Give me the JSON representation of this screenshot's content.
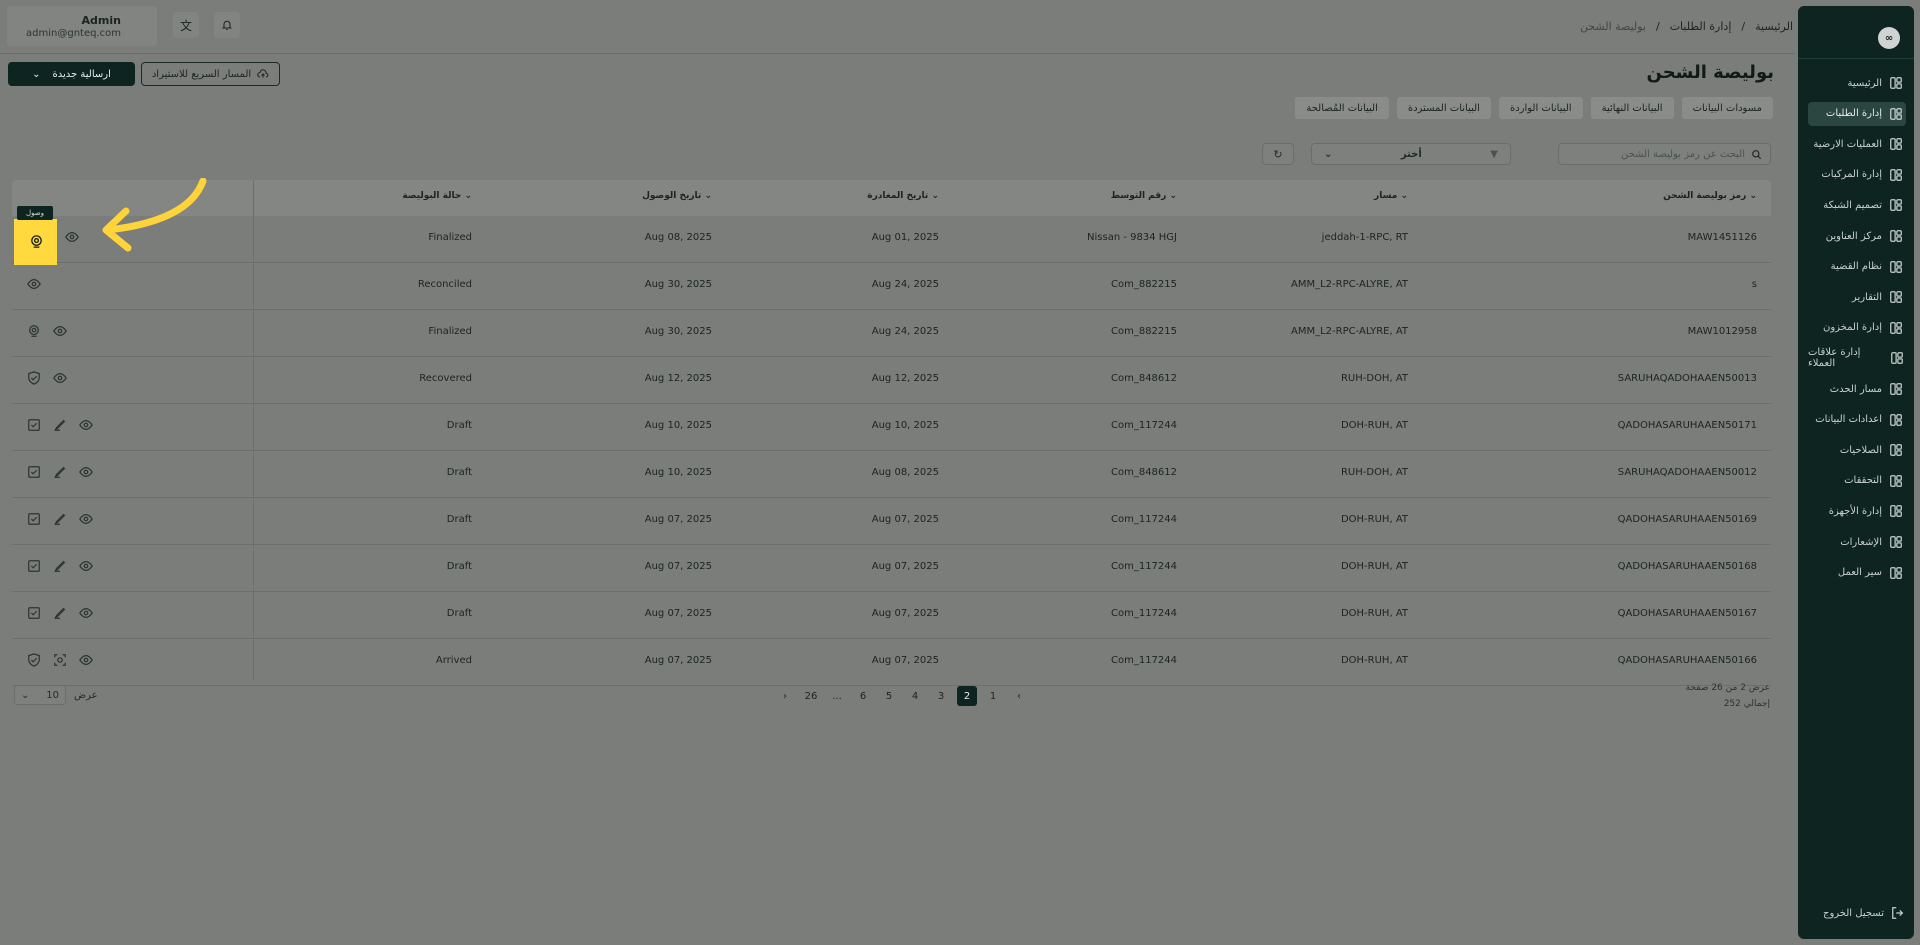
{
  "user": {
    "name": "Admin",
    "email": "admin@gnteq.com"
  },
  "breadcrumb": {
    "home": "الرئيسية",
    "section": "إدارة الطلبات",
    "current": "بوليصة الشحن"
  },
  "page": {
    "title": "بوليصة الشحن",
    "new_button": "ارسالية جديدة",
    "quick_button": "المسار السريع للاستيراد"
  },
  "tabs": [
    "مسودات البيانات",
    "البيانات النهائية",
    "البيانات الواردة",
    "البيانات المستردة",
    "البيانات المُصالحة"
  ],
  "search": {
    "placeholder": "البحث عن رمز بوليصة الشحن"
  },
  "filter": {
    "label": "أختر"
  },
  "sidebar": {
    "items": [
      {
        "label": "الرئيسية",
        "icon": "dashboard-icon"
      },
      {
        "label": "إدارة الطلبات",
        "icon": "orders-icon"
      },
      {
        "label": "العمليات الارضية",
        "icon": "ground-ops-icon"
      },
      {
        "label": "إدارة المركبات",
        "icon": "truck-icon"
      },
      {
        "label": "تصميم الشبكة",
        "icon": "network-icon"
      },
      {
        "label": "مركز العناوين",
        "icon": "address-icon"
      },
      {
        "label": "نظام القضية",
        "icon": "case-icon"
      },
      {
        "label": "التقارير",
        "icon": "reports-icon"
      },
      {
        "label": "إدارة المخزون",
        "icon": "inventory-icon"
      },
      {
        "label": "إدارة علاقات العملاء",
        "icon": "crm-icon"
      },
      {
        "label": "مسار الحدث",
        "icon": "event-path-icon"
      },
      {
        "label": "اعدادات البيانات",
        "icon": "database-icon"
      },
      {
        "label": "الصلاحيات",
        "icon": "users-icon"
      },
      {
        "label": "التحققات",
        "icon": "tools-icon"
      },
      {
        "label": "إدارة الأجهزة",
        "icon": "devices-icon"
      },
      {
        "label": "الإشعارات",
        "icon": "bell-icon"
      },
      {
        "label": "سير العمل",
        "icon": "workflow-icon"
      }
    ],
    "logout": "تسجيل الخروج",
    "logo": "∞"
  },
  "table": {
    "headers": {
      "code": "رمز بوليصة الشحن",
      "route": "مسار",
      "mid": "رقم التوسط",
      "dep": "تاريخ المغادرة",
      "arr": "تاريخ الوصول",
      "status": "حالة البوليصة"
    },
    "rows": [
      {
        "code": "MAW1451126",
        "route": "jeddah-1-RPC, RT",
        "mid": "Nissan - 9834 HGJ",
        "dep": "Aug 01, 2025",
        "arr": "Aug 08, 2025",
        "status": "Finalized",
        "actions": [
          "eye-icon"
        ]
      },
      {
        "code": "s",
        "route": "AMM_L2-RPC-ALYRE, AT",
        "mid": "Com_882215",
        "dep": "Aug 24, 2025",
        "arr": "Aug 30, 2025",
        "status": "Reconciled",
        "actions": [
          "eye-icon"
        ]
      },
      {
        "code": "MAW1012958",
        "route": "AMM_L2-RPC-ALYRE, AT",
        "mid": "Com_882215",
        "dep": "Aug 24, 2025",
        "arr": "Aug 30, 2025",
        "status": "Finalized",
        "actions": [
          "location-icon",
          "eye-icon"
        ]
      },
      {
        "code": "SARUHAQADOHAAEN50013",
        "route": "RUH-DOH, AT",
        "mid": "Com_848612",
        "dep": "Aug 12, 2025",
        "arr": "Aug 12, 2025",
        "status": "Recovered",
        "actions": [
          "shield-icon",
          "eye-icon"
        ]
      },
      {
        "code": "QADOHASARUHAAEN50171",
        "route": "DOH-RUH, AT",
        "mid": "Com_117244",
        "dep": "Aug 10, 2025",
        "arr": "Aug 10, 2025",
        "status": "Draft",
        "actions": [
          "checkbox-icon",
          "edit-icon",
          "eye-icon"
        ]
      },
      {
        "code": "SARUHAQADOHAAEN50012",
        "route": "RUH-DOH, AT",
        "mid": "Com_848612",
        "dep": "Aug 08, 2025",
        "arr": "Aug 10, 2025",
        "status": "Draft",
        "actions": [
          "checkbox-icon",
          "edit-icon",
          "eye-icon"
        ]
      },
      {
        "code": "QADOHASARUHAAEN50169",
        "route": "DOH-RUH, AT",
        "mid": "Com_117244",
        "dep": "Aug 07, 2025",
        "arr": "Aug 07, 2025",
        "status": "Draft",
        "actions": [
          "checkbox-icon",
          "edit-icon",
          "eye-icon"
        ]
      },
      {
        "code": "QADOHASARUHAAEN50168",
        "route": "DOH-RUH, AT",
        "mid": "Com_117244",
        "dep": "Aug 07, 2025",
        "arr": "Aug 07, 2025",
        "status": "Draft",
        "actions": [
          "checkbox-icon",
          "edit-icon",
          "eye-icon"
        ]
      },
      {
        "code": "QADOHASARUHAAEN50167",
        "route": "DOH-RUH, AT",
        "mid": "Com_117244",
        "dep": "Aug 07, 2025",
        "arr": "Aug 07, 2025",
        "status": "Draft",
        "actions": [
          "checkbox-icon",
          "edit-icon",
          "eye-icon"
        ]
      },
      {
        "code": "QADOHASARUHAAEN50166",
        "route": "DOH-RUH, AT",
        "mid": "Com_117244",
        "dep": "Aug 07, 2025",
        "arr": "Aug 07, 2025",
        "status": "Arrived",
        "actions": [
          "shield-icon",
          "scan-icon",
          "eye-icon"
        ]
      }
    ]
  },
  "tooltip": "وصول",
  "pagination": {
    "pages": [
      "1",
      "2",
      "3",
      "4",
      "5",
      "6",
      "...",
      "26"
    ],
    "active": "2",
    "info": "عرض 2 من 26 صفحة",
    "total": "إجمالي 252",
    "per_page_label": "عرض",
    "per_page": "10"
  },
  "colors": {
    "primary": "#0e2420",
    "highlight": "#ffd93d",
    "arrow": "#ffd33a"
  }
}
